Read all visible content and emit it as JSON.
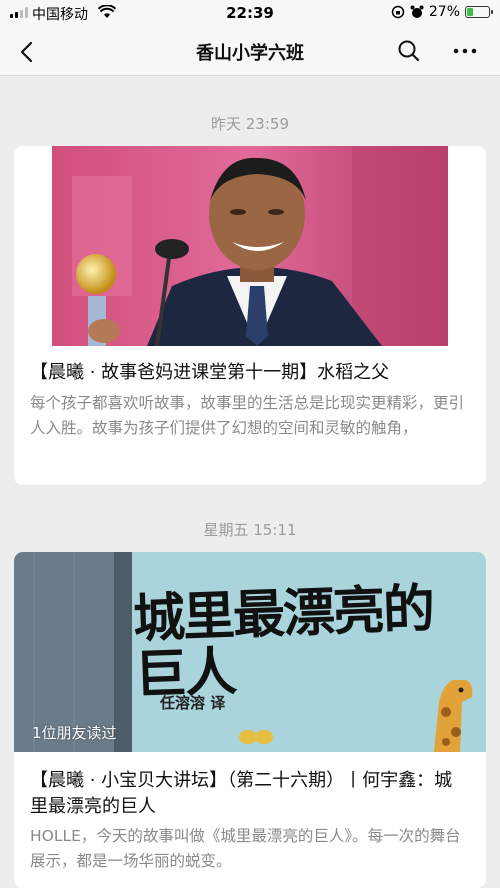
{
  "status_bar": {
    "carrier": "中国移动",
    "time": "22:39",
    "battery_percent": "27%",
    "battery_level": 0.27
  },
  "nav": {
    "title": "香山小学六班",
    "icons": [
      "back-arrow-icon",
      "search-icon",
      "more-icon"
    ]
  },
  "feed": [
    {
      "timestamp": "昨天 23:59",
      "title": "【晨曦 · 故事爸妈进课堂第十一期】水稻之父",
      "desc": "每个孩子都喜欢听故事，故事里的生活总是比现实更精彩，更引人入胜。故事为孩子们提供了幻想的空间和灵敏的触角，"
    },
    {
      "timestamp": "星期五 15:11",
      "cover_text_title": "城里最漂亮的巨人",
      "cover_text_author": "任溶溶 译",
      "friend_read": "1位朋友读过",
      "title": "【晨曦 · 小宝贝大讲坛】（第二十六期）丨何宇鑫：城里最漂亮的巨人",
      "desc": "HOLLE，今天的故事叫做《城里最漂亮的巨人》。每一次的舞台展示，都是一场华丽的蜕变。"
    }
  ],
  "colors": {
    "background": "#ededed",
    "card": "#ffffff",
    "muted_text": "#9b9b9b",
    "battery_green": "#3cc04a"
  }
}
